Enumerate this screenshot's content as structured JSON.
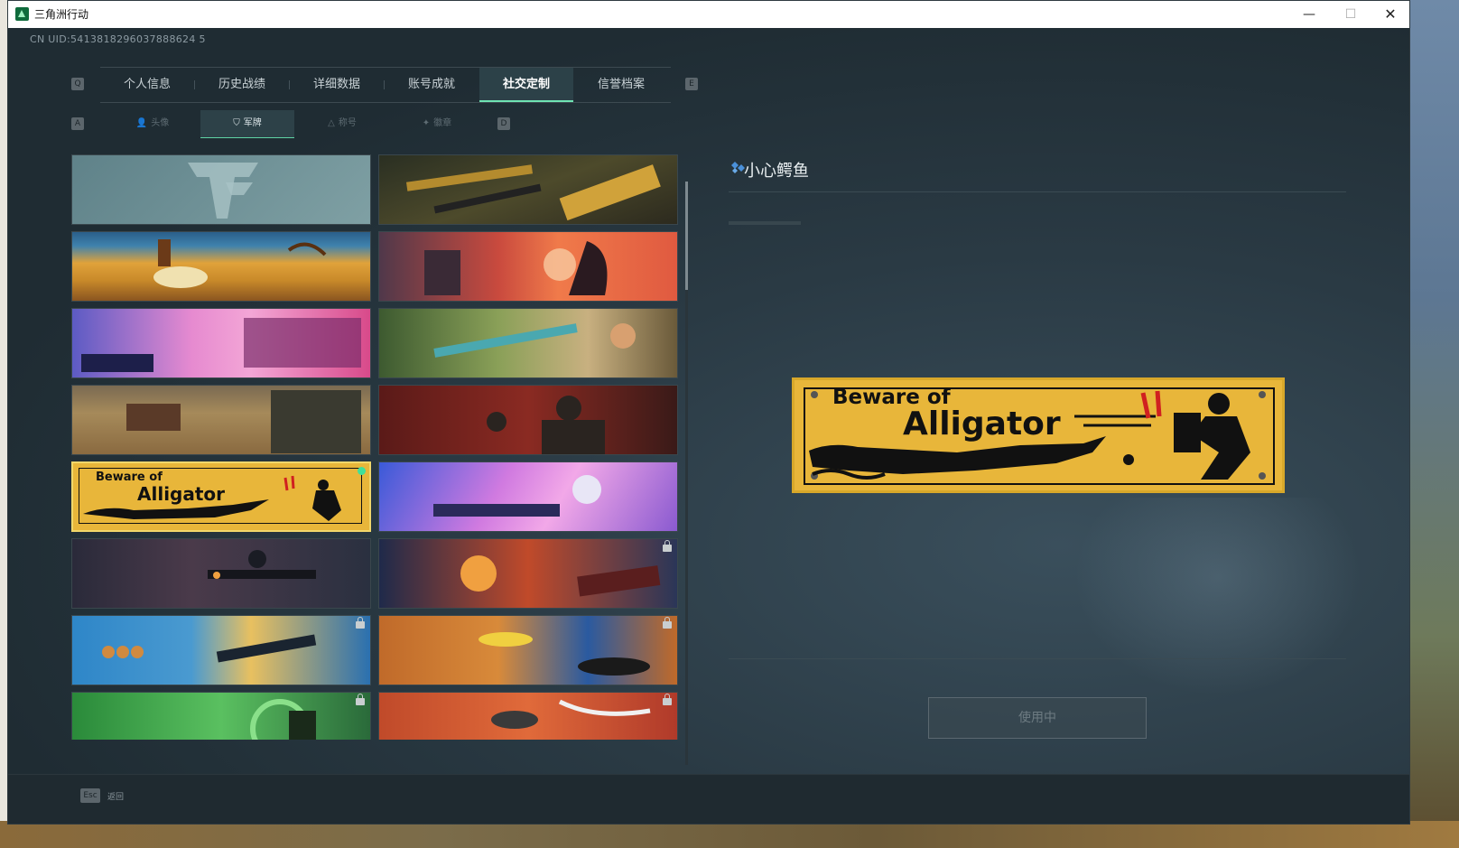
{
  "window": {
    "title": "三角洲行动",
    "controls": {
      "minimize": "—",
      "maximize": "☐",
      "close": "✕"
    }
  },
  "uid": "CN UID:5413818296037888624 5",
  "main_tabs": {
    "left_key": "Q",
    "right_key": "E",
    "items": [
      {
        "label": "个人信息",
        "active": false
      },
      {
        "label": "历史战绩",
        "active": false
      },
      {
        "label": "详细数据",
        "active": false
      },
      {
        "label": "账号成就",
        "active": false
      },
      {
        "label": "社交定制",
        "active": true
      },
      {
        "label": "信誉档案",
        "active": false
      }
    ]
  },
  "sub_tabs": {
    "left_key": "A",
    "right_key": "D",
    "items": [
      {
        "label": "头像",
        "icon": "person-icon",
        "active": false
      },
      {
        "label": "军牌",
        "icon": "badge-icon",
        "active": true
      },
      {
        "label": "称号",
        "icon": "title-icon",
        "active": false
      },
      {
        "label": "徽章",
        "icon": "emblem-icon",
        "active": false
      }
    ]
  },
  "cards": [
    {
      "name": "default-logo",
      "locked": false,
      "selected": false
    },
    {
      "name": "weapons-table",
      "locked": false,
      "selected": false
    },
    {
      "name": "desert-surreal",
      "locked": false,
      "selected": false
    },
    {
      "name": "sunset-girl",
      "locked": false,
      "selected": false
    },
    {
      "name": "pink-city",
      "locked": false,
      "selected": false
    },
    {
      "name": "engineer-girl",
      "locked": false,
      "selected": false
    },
    {
      "name": "desert-town",
      "locked": false,
      "selected": false
    },
    {
      "name": "soldiers-red",
      "locked": false,
      "selected": false
    },
    {
      "name": "beware-alligator",
      "locked": false,
      "selected": true
    },
    {
      "name": "anime-silver",
      "locked": false,
      "selected": false
    },
    {
      "name": "night-assault",
      "locked": false,
      "selected": false
    },
    {
      "name": "explosion-orange",
      "locked": true,
      "selected": false
    },
    {
      "name": "blue-cookies",
      "locked": true,
      "selected": false
    },
    {
      "name": "orange-drones",
      "locked": true,
      "selected": false
    },
    {
      "name": "green-swirl",
      "locked": true,
      "selected": false
    },
    {
      "name": "red-shark",
      "locked": true,
      "selected": false
    }
  ],
  "plate_text": {
    "line1": "Beware of",
    "line2": "Alligator"
  },
  "detail": {
    "title": "小心鳄鱼",
    "use_button": "使用中"
  },
  "bottom": {
    "esc_key": "Esc",
    "back_label": "返回"
  },
  "colors": {
    "accent_green": "#6fe3b3",
    "plate_yellow": "#e8b63a",
    "selected_border": "#f1d76a",
    "diamond_blue": "#4a90d9"
  }
}
